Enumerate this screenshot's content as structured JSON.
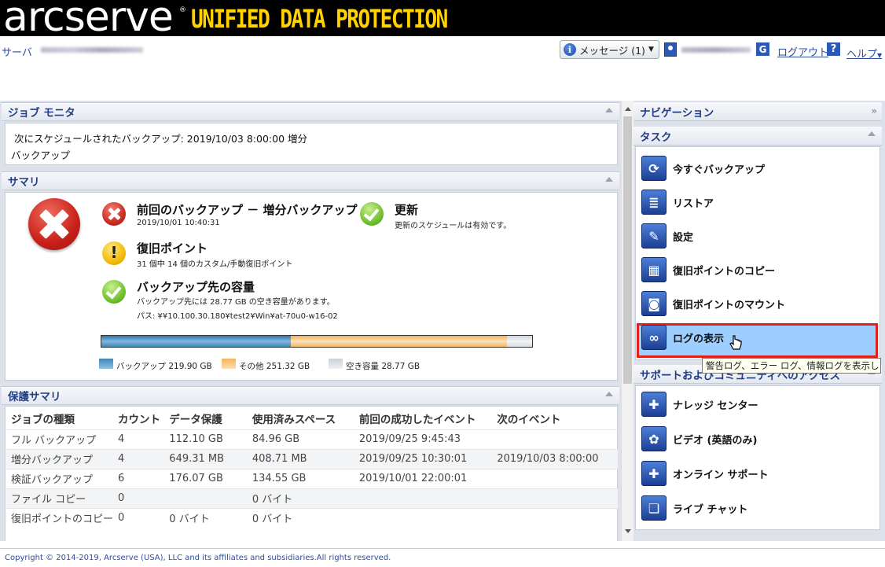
{
  "brand": {
    "logo": "arcserve",
    "reg": "®",
    "product": "UNIFIED DATA PROTECTION"
  },
  "topbar": {
    "server_label": "サーバ",
    "messages_label": "メッセージ (1)",
    "logout_label": "ログアウト",
    "help_label": "ヘルプ"
  },
  "job_monitor": {
    "title": "ジョブ モニタ",
    "line1": "次にスケジュールされたバックアップ: 2019/10/03 8:00:00 増分",
    "line2": "バックアップ"
  },
  "summary": {
    "title": "サマリ",
    "last_backup": {
      "title": "前回のバックアップ － 増分バックアップ",
      "sub": "2019/10/01 10:40:31",
      "status": "error"
    },
    "update": {
      "title": "更新",
      "sub": "更新のスケジュールは有効です。",
      "status": "ok"
    },
    "recovery": {
      "title": "復旧ポイント",
      "sub": "31 個中 14 個のカスタム/手動復旧ポイント",
      "status": "warning"
    },
    "capacity": {
      "title": "バックアップ先の容量",
      "sub1": "バックアップ先には 28.77 GB の空き容量があります。",
      "sub2": "パス: ¥¥10.100.30.180¥test2¥Win¥at-70u0-w16-02",
      "segments": [
        {
          "label": "バックアップ 219.90 GB",
          "value": 219.9,
          "color": "#4f94c2"
        },
        {
          "label": "その他 251.32 GB",
          "value": 251.32,
          "color": "#f5c98a"
        },
        {
          "label": "空き容量 28.77 GB",
          "value": 28.77,
          "color": "#dde2e8"
        }
      ]
    }
  },
  "protection": {
    "title": "保護サマリ",
    "columns": [
      "ジョブの種類",
      "カウント",
      "データ保護",
      "使用済みスペース",
      "前回の成功したイベント",
      "次のイベント"
    ],
    "rows": [
      [
        "フル バックアップ",
        "4",
        "112.10 GB",
        "84.96 GB",
        "2019/09/25 9:45:43",
        ""
      ],
      [
        "増分バックアップ",
        "4",
        "649.31 MB",
        "408.71 MB",
        "2019/09/25 10:30:01",
        "2019/10/03 8:00:00"
      ],
      [
        "検証バックアップ",
        "6",
        "176.07 GB",
        "134.55 GB",
        "2019/10/01 22:00:01",
        ""
      ],
      [
        "ファイル コピー",
        "0",
        "",
        "0 バイト",
        "",
        ""
      ],
      [
        "復旧ポイントのコピー",
        "0",
        "0 バイト",
        "0 バイト",
        "",
        ""
      ]
    ]
  },
  "navigation": {
    "title": "ナビゲーション",
    "tasks_title": "タスク",
    "tasks": [
      {
        "label": "今すぐバックアップ",
        "icon": "backup-now-icon",
        "glyph": "⟳"
      },
      {
        "label": "リストア",
        "icon": "restore-icon",
        "glyph": "≣"
      },
      {
        "label": "設定",
        "icon": "wrench-icon",
        "glyph": "✎"
      },
      {
        "label": "復旧ポイントのコピー",
        "icon": "copy-recovery-point-icon",
        "glyph": "▦"
      },
      {
        "label": "復旧ポイントのマウント",
        "icon": "mount-recovery-point-icon",
        "glyph": "◙"
      },
      {
        "label": "ログの表示",
        "icon": "view-logs-icon",
        "glyph": "∞"
      }
    ],
    "tooltip": "警告ログ、エラー ログ、情報ログを表示します",
    "support_title": "サポートおよびコミュニティへのアクセス",
    "support": [
      {
        "label": "ナレッジ センター",
        "icon": "knowledge-center-icon",
        "glyph": "✚"
      },
      {
        "label": "ビデオ (英語のみ)",
        "icon": "video-icon",
        "glyph": "✿"
      },
      {
        "label": "オンライン サポート",
        "icon": "online-support-icon",
        "glyph": "✚"
      },
      {
        "label": "ライブ チャット",
        "icon": "live-chat-icon",
        "glyph": "❏"
      }
    ]
  },
  "footer": {
    "copyright": "Copyright © 2014-2019, Arcserve (USA), LLC and its affiliates and subsidiaries.All rights reserved."
  }
}
